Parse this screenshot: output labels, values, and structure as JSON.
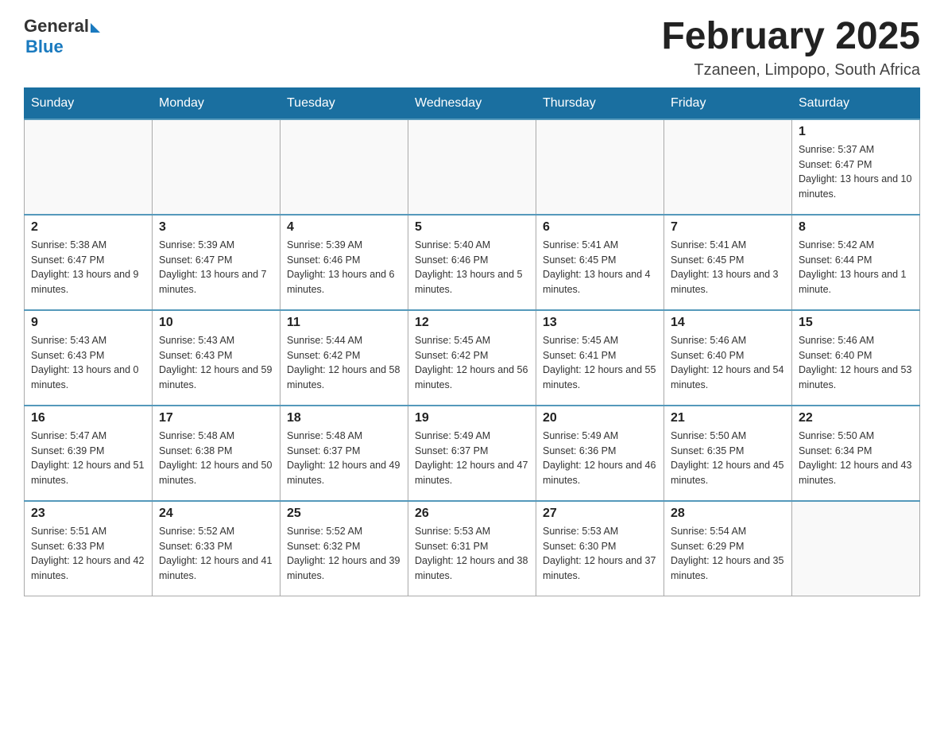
{
  "header": {
    "logo_general": "General",
    "logo_blue": "Blue",
    "main_title": "February 2025",
    "subtitle": "Tzaneen, Limpopo, South Africa"
  },
  "days_of_week": [
    "Sunday",
    "Monday",
    "Tuesday",
    "Wednesday",
    "Thursday",
    "Friday",
    "Saturday"
  ],
  "weeks": [
    [
      {
        "day": "",
        "info": ""
      },
      {
        "day": "",
        "info": ""
      },
      {
        "day": "",
        "info": ""
      },
      {
        "day": "",
        "info": ""
      },
      {
        "day": "",
        "info": ""
      },
      {
        "day": "",
        "info": ""
      },
      {
        "day": "1",
        "info": "Sunrise: 5:37 AM\nSunset: 6:47 PM\nDaylight: 13 hours and 10 minutes."
      }
    ],
    [
      {
        "day": "2",
        "info": "Sunrise: 5:38 AM\nSunset: 6:47 PM\nDaylight: 13 hours and 9 minutes."
      },
      {
        "day": "3",
        "info": "Sunrise: 5:39 AM\nSunset: 6:47 PM\nDaylight: 13 hours and 7 minutes."
      },
      {
        "day": "4",
        "info": "Sunrise: 5:39 AM\nSunset: 6:46 PM\nDaylight: 13 hours and 6 minutes."
      },
      {
        "day": "5",
        "info": "Sunrise: 5:40 AM\nSunset: 6:46 PM\nDaylight: 13 hours and 5 minutes."
      },
      {
        "day": "6",
        "info": "Sunrise: 5:41 AM\nSunset: 6:45 PM\nDaylight: 13 hours and 4 minutes."
      },
      {
        "day": "7",
        "info": "Sunrise: 5:41 AM\nSunset: 6:45 PM\nDaylight: 13 hours and 3 minutes."
      },
      {
        "day": "8",
        "info": "Sunrise: 5:42 AM\nSunset: 6:44 PM\nDaylight: 13 hours and 1 minute."
      }
    ],
    [
      {
        "day": "9",
        "info": "Sunrise: 5:43 AM\nSunset: 6:43 PM\nDaylight: 13 hours and 0 minutes."
      },
      {
        "day": "10",
        "info": "Sunrise: 5:43 AM\nSunset: 6:43 PM\nDaylight: 12 hours and 59 minutes."
      },
      {
        "day": "11",
        "info": "Sunrise: 5:44 AM\nSunset: 6:42 PM\nDaylight: 12 hours and 58 minutes."
      },
      {
        "day": "12",
        "info": "Sunrise: 5:45 AM\nSunset: 6:42 PM\nDaylight: 12 hours and 56 minutes."
      },
      {
        "day": "13",
        "info": "Sunrise: 5:45 AM\nSunset: 6:41 PM\nDaylight: 12 hours and 55 minutes."
      },
      {
        "day": "14",
        "info": "Sunrise: 5:46 AM\nSunset: 6:40 PM\nDaylight: 12 hours and 54 minutes."
      },
      {
        "day": "15",
        "info": "Sunrise: 5:46 AM\nSunset: 6:40 PM\nDaylight: 12 hours and 53 minutes."
      }
    ],
    [
      {
        "day": "16",
        "info": "Sunrise: 5:47 AM\nSunset: 6:39 PM\nDaylight: 12 hours and 51 minutes."
      },
      {
        "day": "17",
        "info": "Sunrise: 5:48 AM\nSunset: 6:38 PM\nDaylight: 12 hours and 50 minutes."
      },
      {
        "day": "18",
        "info": "Sunrise: 5:48 AM\nSunset: 6:37 PM\nDaylight: 12 hours and 49 minutes."
      },
      {
        "day": "19",
        "info": "Sunrise: 5:49 AM\nSunset: 6:37 PM\nDaylight: 12 hours and 47 minutes."
      },
      {
        "day": "20",
        "info": "Sunrise: 5:49 AM\nSunset: 6:36 PM\nDaylight: 12 hours and 46 minutes."
      },
      {
        "day": "21",
        "info": "Sunrise: 5:50 AM\nSunset: 6:35 PM\nDaylight: 12 hours and 45 minutes."
      },
      {
        "day": "22",
        "info": "Sunrise: 5:50 AM\nSunset: 6:34 PM\nDaylight: 12 hours and 43 minutes."
      }
    ],
    [
      {
        "day": "23",
        "info": "Sunrise: 5:51 AM\nSunset: 6:33 PM\nDaylight: 12 hours and 42 minutes."
      },
      {
        "day": "24",
        "info": "Sunrise: 5:52 AM\nSunset: 6:33 PM\nDaylight: 12 hours and 41 minutes."
      },
      {
        "day": "25",
        "info": "Sunrise: 5:52 AM\nSunset: 6:32 PM\nDaylight: 12 hours and 39 minutes."
      },
      {
        "day": "26",
        "info": "Sunrise: 5:53 AM\nSunset: 6:31 PM\nDaylight: 12 hours and 38 minutes."
      },
      {
        "day": "27",
        "info": "Sunrise: 5:53 AM\nSunset: 6:30 PM\nDaylight: 12 hours and 37 minutes."
      },
      {
        "day": "28",
        "info": "Sunrise: 5:54 AM\nSunset: 6:29 PM\nDaylight: 12 hours and 35 minutes."
      },
      {
        "day": "",
        "info": ""
      }
    ]
  ]
}
